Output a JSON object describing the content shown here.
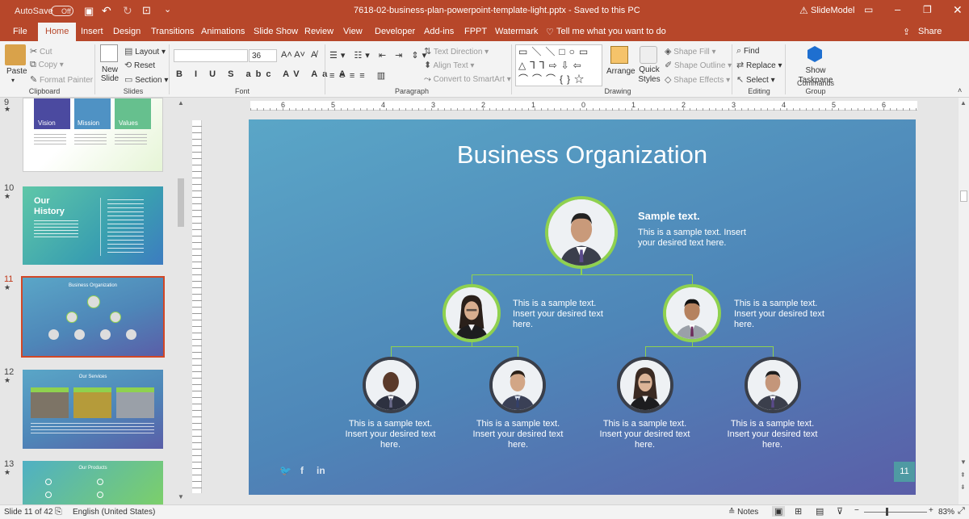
{
  "titlebar": {
    "autosave": "AutoSave",
    "autosave_state": "Off",
    "doc_title": "7618-02-business-plan-powerpoint-template-light.pptx  -  Saved to this PC",
    "account": "SlideModel"
  },
  "tabs": [
    "File",
    "Home",
    "Insert",
    "Design",
    "Transitions",
    "Animations",
    "Slide Show",
    "Review",
    "View",
    "Developer",
    "Add-ins",
    "FPPT",
    "Watermark"
  ],
  "tell_me": "Tell me what you want to do",
  "share": "Share",
  "ribbon": {
    "clipboard": {
      "paste": "Paste",
      "cut": "Cut",
      "copy": "Copy",
      "format_painter": "Format Painter",
      "label": "Clipboard"
    },
    "slides": {
      "new_slide": "New Slide",
      "layout": "Layout",
      "reset": "Reset",
      "section": "Section",
      "label": "Slides"
    },
    "font": {
      "size": "36",
      "label": "Font"
    },
    "paragraph": {
      "text_direction": "Text Direction",
      "align_text": "Align Text",
      "smartart": "Convert to SmartArt",
      "label": "Paragraph"
    },
    "drawing": {
      "arrange": "Arrange",
      "quick_styles": "Quick Styles",
      "shape_fill": "Shape Fill",
      "shape_outline": "Shape Outline",
      "shape_effects": "Shape Effects",
      "label": "Drawing"
    },
    "editing": {
      "find": "Find",
      "replace": "Replace",
      "select": "Select",
      "label": "Editing"
    },
    "commands": {
      "show_taskpane": "Show Taskpane",
      "label": "Commands Group"
    }
  },
  "thumbnails": [
    {
      "num": "9",
      "title": "",
      "labels": [
        "Vision",
        "Mission",
        "Values"
      ]
    },
    {
      "num": "10",
      "title": "Our History"
    },
    {
      "num": "11",
      "title": "Business Organization"
    },
    {
      "num": "12",
      "title": "Our Services"
    },
    {
      "num": "13",
      "title": "Our Products"
    }
  ],
  "slide": {
    "title": "Business Organization",
    "ceo_heading": "Sample text.",
    "ceo_text": "This is a sample text. Insert your desired text here.",
    "mid_text": "This is a sample text. Insert your desired text here.",
    "bottom_text": "This is a sample text. Insert your desired text here.",
    "page_number": "11",
    "colors": {
      "accent_green": "#8fd14f",
      "dark_ring": "#3a3f4a",
      "page_box": "#4f9aa3"
    }
  },
  "status": {
    "slide_of": "Slide 11 of 42",
    "language": "English (United States)",
    "notes": "Notes",
    "zoom": "83%"
  },
  "ruler_numbers": [
    "6",
    "5",
    "4",
    "3",
    "2",
    "1",
    "0",
    "1",
    "2",
    "3",
    "4",
    "5",
    "6"
  ]
}
